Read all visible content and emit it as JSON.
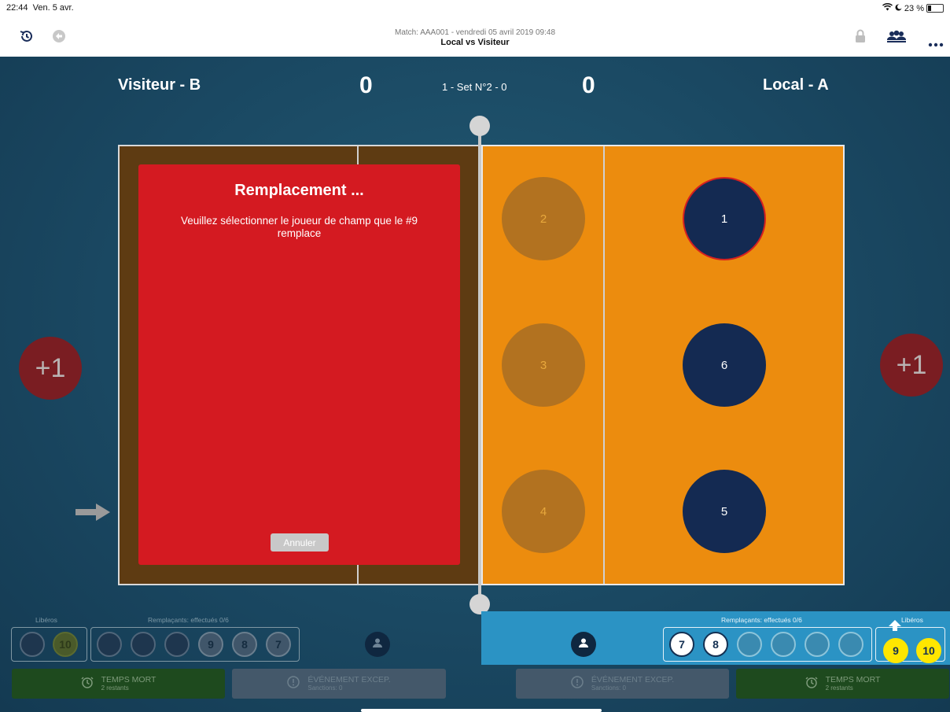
{
  "status": {
    "time": "22:44",
    "date": "Ven. 5 avr.",
    "battery": "23 %",
    "battery_level": 0.23
  },
  "header": {
    "match_line": "Match: AAA001 - vendredi 05 avril 2019 09:48",
    "teams_line": "Local  vs  Visiteur"
  },
  "score": {
    "left_team": "Visiteur - B",
    "left_score": "0",
    "set_label": "1 - Set N°2 - 0",
    "right_score": "0",
    "right_team": "Local - A"
  },
  "court": {
    "left_positions": [
      {
        "number": "2"
      },
      {
        "number": "3"
      },
      {
        "number": "4"
      }
    ],
    "right_positions": [
      {
        "number": "1"
      },
      {
        "number": "6"
      },
      {
        "number": "5"
      }
    ]
  },
  "point_buttons": {
    "left": "+1",
    "right": "+1"
  },
  "modal": {
    "title": "Remplacement ...",
    "message": "Veuillez sélectionner le joueur de champ que le #9 remplace",
    "cancel": "Annuler"
  },
  "bench_left": {
    "liberos_label": "Libéros",
    "liberos": [
      "",
      "10"
    ],
    "subs_label": "Remplaçants: effectués 0/6",
    "subs": [
      "",
      "",
      "",
      "9",
      "8",
      "7"
    ]
  },
  "bench_right": {
    "subs_label": "Remplaçants: effectués 0/6",
    "subs": [
      "7",
      "8",
      "",
      "",
      "",
      ""
    ],
    "liberos_label": "Libéros",
    "liberos": [
      "9",
      "10"
    ]
  },
  "actions": {
    "left_timeout": {
      "label": "TEMPS MORT",
      "sub": "2 restants"
    },
    "left_event": {
      "label": "ÉVÉNEMENT EXCEP.",
      "sub": "Sanctions: 0"
    },
    "right_event": {
      "label": "ÉVÉNEMENT EXCEP.",
      "sub": "Sanctions: 0"
    },
    "right_timeout": {
      "label": "TEMPS MORT",
      "sub": "2 restants"
    }
  },
  "colors": {
    "court_right": "#ec8c0e",
    "court_left": "#5e3b12",
    "modal": "#d41a21",
    "team_blue": "#142a52",
    "libero_yellow": "#ffe600",
    "timeout_green": "#1e4a1e"
  }
}
